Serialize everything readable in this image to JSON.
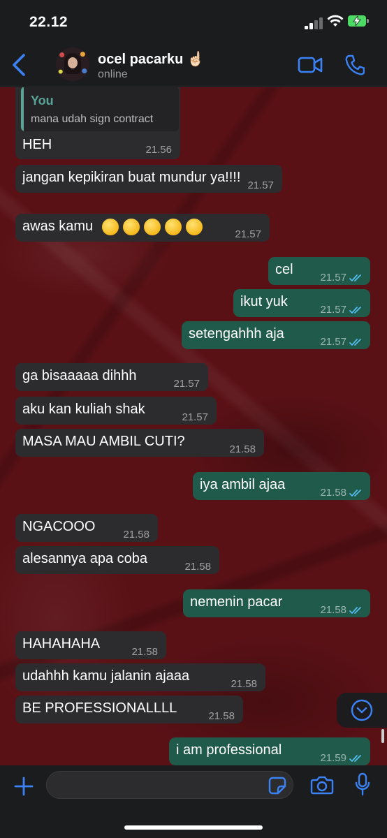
{
  "status_bar": {
    "time": "22.12"
  },
  "header": {
    "contact_name": "ocel pacarku ☝🏻",
    "status": "online"
  },
  "reply": {
    "quote_author": "You",
    "quote_text": "mana udah sign contract",
    "text": "HEH",
    "time": "21.56"
  },
  "messages": [
    {
      "dir": "in",
      "text": "jangan kepikiran buat mundur ya!!!!",
      "time": "21.57"
    },
    {
      "dir": "in",
      "text": "awas kamu",
      "time": "21.57",
      "emoji_count": 5,
      "emoji": "😤"
    },
    {
      "dir": "out",
      "text": "cel",
      "time": "21.57",
      "read": true
    },
    {
      "dir": "out",
      "text": "ikut yuk",
      "time": "21.57",
      "read": true
    },
    {
      "dir": "out",
      "text": "setengahhh aja",
      "time": "21.57",
      "read": true
    },
    {
      "dir": "in",
      "text": "ga bisaaaaa dihhh",
      "time": "21.57"
    },
    {
      "dir": "in",
      "text": "aku kan kuliah shak",
      "time": "21.57"
    },
    {
      "dir": "in",
      "text": "MASA MAU AMBIL CUTI?",
      "time": "21.58"
    },
    {
      "dir": "out",
      "text": "iya ambil ajaa",
      "time": "21.58",
      "read": true
    },
    {
      "dir": "in",
      "text": "NGACOOO",
      "time": "21.58"
    },
    {
      "dir": "in",
      "text": "alesannya apa coba",
      "time": "21.58"
    },
    {
      "dir": "out",
      "text": "nemenin pacar",
      "time": "21.58",
      "read": true
    },
    {
      "dir": "in",
      "text": "HAHAHAHA",
      "time": "21.58"
    },
    {
      "dir": "in",
      "text": "udahhh kamu jalanin ajaaa",
      "time": "21.58"
    },
    {
      "dir": "in",
      "text": "BE PROFESSIONALLLL",
      "time": "21.58"
    },
    {
      "dir": "out",
      "text": "i am professional",
      "time": "21.59",
      "read": true
    }
  ],
  "input": {
    "placeholder": "",
    "value": ""
  },
  "colors": {
    "incoming_bubble": "#2c2c2e",
    "outgoing_bubble": "#1f5a4b",
    "accent": "#3b82f6",
    "read_ticks": "#53bdeb",
    "quote_accent": "#5aa396"
  },
  "icons": {
    "back": "chevron-left-icon",
    "video": "video-camera-icon",
    "call": "phone-icon",
    "add": "plus-icon",
    "sticker": "sticker-icon",
    "camera": "camera-icon",
    "mic": "microphone-icon",
    "scroll_down": "chevron-down-circle-icon"
  }
}
